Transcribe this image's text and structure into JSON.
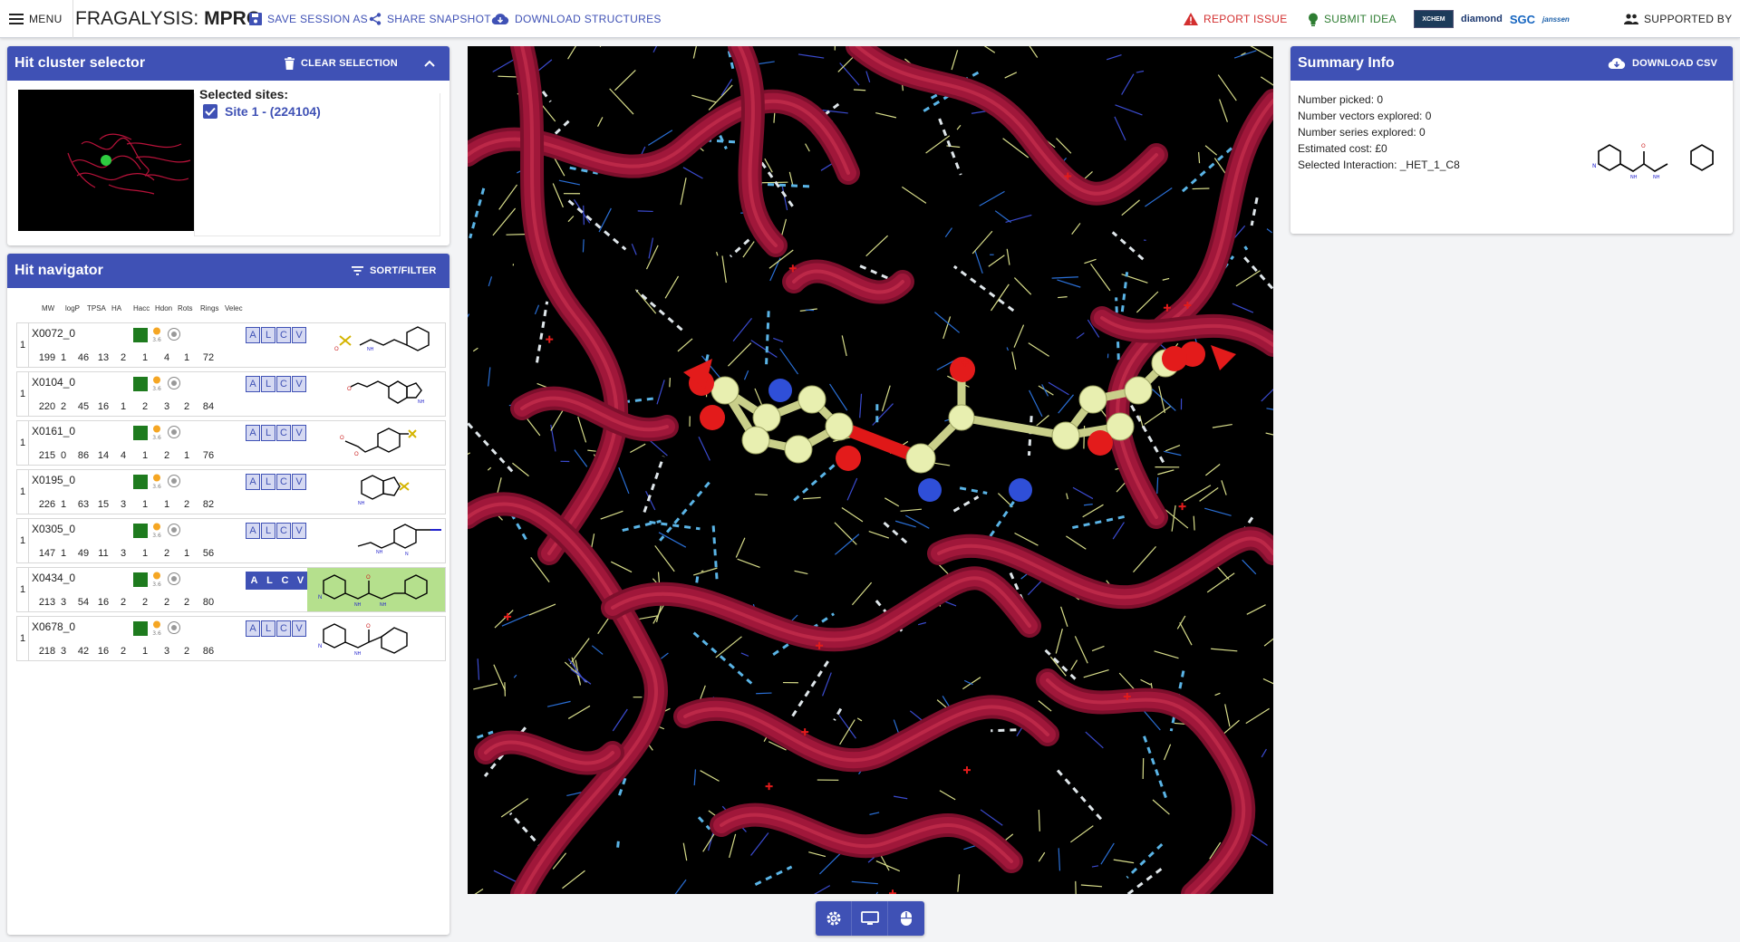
{
  "header": {
    "menu_label": "MENU",
    "brand_prefix": "FRAGALYSIS:",
    "brand_target": "MPRO",
    "save_label": "SAVE SESSION AS",
    "share_label": "SHARE SNAPSHOT",
    "download_label": "DOWNLOAD STRUCTURES",
    "report_label": "REPORT ISSUE",
    "idea_label": "SUBMIT IDEA",
    "supported_label": "SUPPORTED BY",
    "logos": [
      "XCHEM",
      "diamond",
      "SGC",
      "janssen"
    ]
  },
  "cluster_panel": {
    "title": "Hit cluster selector",
    "clear_label": "CLEAR SELECTION",
    "sites_label": "Selected sites:",
    "sites": [
      {
        "label": "Site 1 - (224104)",
        "checked": true
      }
    ]
  },
  "navigator": {
    "title": "Hit navigator",
    "sort_label": "SORT/FILTER",
    "columns": [
      "MW",
      "logP",
      "TPSA",
      "HA",
      "Hacc",
      "Hdon",
      "Rots",
      "Rings",
      "Velec"
    ],
    "rows": [
      {
        "num": "1",
        "name": "X0072_0",
        "props": [
          "199",
          "1",
          "46",
          "13",
          "2",
          "1",
          "4",
          "1",
          "72"
        ],
        "selected": false
      },
      {
        "num": "1",
        "name": "X0104_0",
        "props": [
          "220",
          "2",
          "45",
          "16",
          "1",
          "2",
          "3",
          "2",
          "84"
        ],
        "selected": false
      },
      {
        "num": "1",
        "name": "X0161_0",
        "props": [
          "215",
          "0",
          "86",
          "14",
          "4",
          "1",
          "2",
          "1",
          "76"
        ],
        "selected": false
      },
      {
        "num": "1",
        "name": "X0195_0",
        "props": [
          "226",
          "1",
          "63",
          "15",
          "3",
          "1",
          "1",
          "2",
          "82"
        ],
        "selected": false
      },
      {
        "num": "1",
        "name": "X0305_0",
        "props": [
          "147",
          "1",
          "49",
          "11",
          "3",
          "1",
          "2",
          "1",
          "56"
        ],
        "selected": false
      },
      {
        "num": "1",
        "name": "X0434_0",
        "props": [
          "213",
          "3",
          "54",
          "16",
          "2",
          "2",
          "2",
          "2",
          "80"
        ],
        "selected": true
      },
      {
        "num": "1",
        "name": "X0678_0",
        "props": [
          "218",
          "3",
          "42",
          "16",
          "2",
          "1",
          "3",
          "2",
          "86"
        ],
        "selected": false
      }
    ],
    "toggle_letters": [
      "A",
      "L",
      "C",
      "V"
    ],
    "dot_label": "3.6"
  },
  "summary": {
    "title": "Summary Info",
    "download_csv_label": "DOWNLOAD CSV",
    "lines": [
      "Number picked: 0",
      "Number vectors explored: 0",
      "Number series explored: 0",
      "Estimated cost: £0",
      "Selected Interaction: _HET_1_C8"
    ]
  },
  "colors": {
    "primary": "#3f51b5",
    "report": "#d32f2f",
    "idea": "#2e7d32",
    "selected_row": "#b5e08d",
    "ribbon": "#a0173a"
  }
}
